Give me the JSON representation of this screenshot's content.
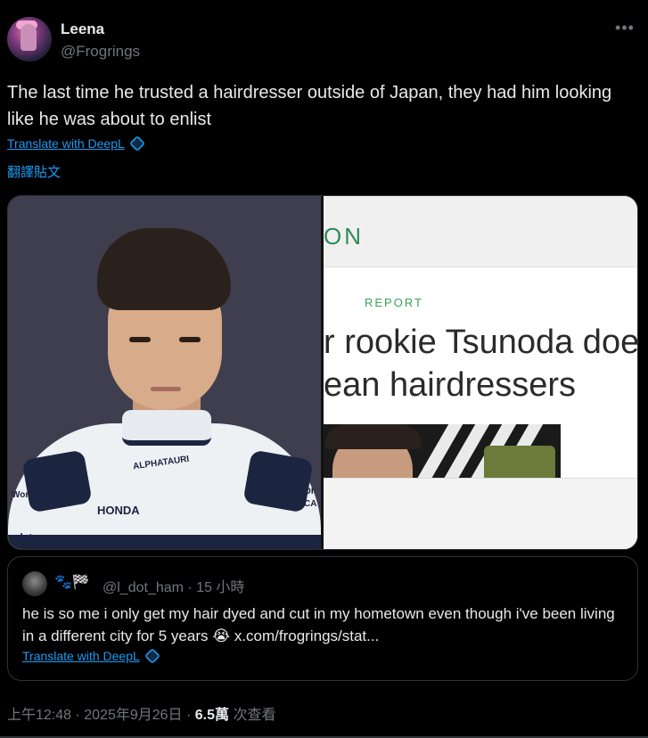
{
  "author": {
    "display_name": "Leena",
    "handle": "@Frogrings"
  },
  "post": {
    "text": "The last time he trusted a hairdresser outside of Japan, they had him looking like he was about to enlist",
    "translate_label": "Translate with DeepL",
    "translate_post_label": "翻譯貼文"
  },
  "media": {
    "left_image": {
      "suit_texts": [
        "ALPHATAURI",
        "HONDA",
        "World",
        "EDI",
        "CA",
        "ndstau"
      ]
    },
    "right_image": {
      "logo_fragment": "ON",
      "category": "REPORT",
      "headline_line1": "r rookie Tsunoda doe",
      "headline_line2": "ean hairdressers"
    }
  },
  "quote": {
    "badges": "🐾🏁",
    "handle_time": "@l_dot_ham · 15 小時",
    "text": "he is so me i only get my hair dyed and cut in my hometown even though i've been living in a different city for 5 years 😭 x.com/frogrings/stat...",
    "translate_label": "Translate with DeepL"
  },
  "meta": {
    "timestamp": "上午12:48 · 2025年9月26日 · ",
    "views": "6.5萬",
    "views_label": " 次查看"
  },
  "icons": {
    "more": "more-horizontal-icon",
    "deepl": "deepl-icon"
  }
}
